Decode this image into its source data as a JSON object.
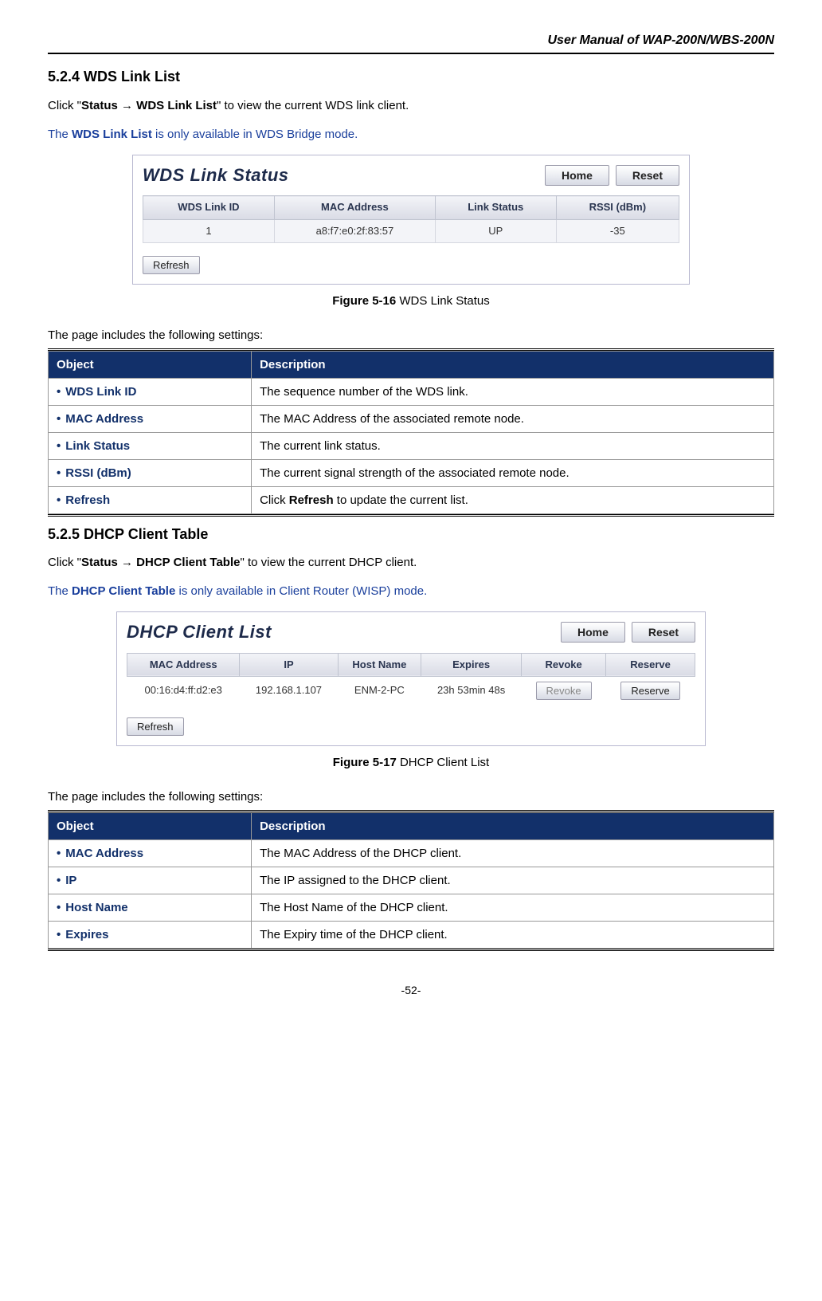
{
  "header": {
    "title": "User Manual of WAP-200N/WBS-200N"
  },
  "section_524": {
    "heading": "5.2.4  WDS Link List",
    "nav_pre": "Click \"",
    "nav_path": "Status → WDS Link List",
    "nav_post": "\" to view the current WDS link client.",
    "note_pre": "The ",
    "note_b": "WDS Link List",
    "note_post": " is only available in WDS Bridge mode.",
    "panel": {
      "title": "WDS Link Status",
      "home": "Home",
      "reset": "Reset",
      "cols": {
        "c1": "WDS Link ID",
        "c2": "MAC Address",
        "c3": "Link Status",
        "c4": "RSSI (dBm)"
      },
      "row": {
        "id": "1",
        "mac": "a8:f7:e0:2f:83:57",
        "status": "UP",
        "rssi": "-35"
      },
      "refresh": "Refresh"
    },
    "caption_b": "Figure 5-16",
    "caption_txt": " WDS Link Status",
    "settings_intro": "The page includes the following settings:",
    "desc_table": {
      "h1": "Object",
      "h2": "Description",
      "rows": [
        {
          "obj": "WDS Link ID",
          "desc": "The sequence number of the WDS link."
        },
        {
          "obj": "MAC Address",
          "desc": "The MAC Address of the associated remote node."
        },
        {
          "obj": "Link Status",
          "desc": "The current link status."
        },
        {
          "obj": "RSSI (dBm)",
          "desc": "The current signal strength of the associated remote node."
        },
        {
          "obj": "Refresh",
          "desc_pre": "Click ",
          "desc_b": "Refresh",
          "desc_post": " to update the current list."
        }
      ]
    }
  },
  "section_525": {
    "heading": "5.2.5  DHCP Client Table",
    "nav_pre": "Click \"",
    "nav_path": "Status → DHCP Client Table",
    "nav_post": "\" to view the current DHCP client.",
    "note_pre": "The ",
    "note_b": "DHCP Client Table",
    "note_post": " is only available in Client Router (WISP) mode.",
    "panel": {
      "title": "DHCP Client List",
      "home": "Home",
      "reset": "Reset",
      "cols": {
        "c1": "MAC Address",
        "c2": "IP",
        "c3": "Host Name",
        "c4": "Expires",
        "c5": "Revoke",
        "c6": "Reserve"
      },
      "row": {
        "mac": "00:16:d4:ff:d2:e3",
        "ip": "192.168.1.107",
        "host": "ENM-2-PC",
        "exp": "23h 53min 48s",
        "revoke": "Revoke",
        "reserve": "Reserve"
      },
      "refresh": "Refresh"
    },
    "caption_b": "Figure 5-17",
    "caption_txt": " DHCP Client List",
    "settings_intro": "The page includes the following settings:",
    "desc_table": {
      "h1": "Object",
      "h2": "Description",
      "rows": [
        {
          "obj": "MAC Address",
          "desc": "The MAC Address of the DHCP client."
        },
        {
          "obj": "IP",
          "desc": "The IP assigned to the DHCP client."
        },
        {
          "obj": "Host Name",
          "desc": "The Host Name of the DHCP client."
        },
        {
          "obj": "Expires",
          "desc": "The Expiry time of the DHCP client."
        }
      ]
    }
  },
  "footer": {
    "page": "-52-"
  }
}
